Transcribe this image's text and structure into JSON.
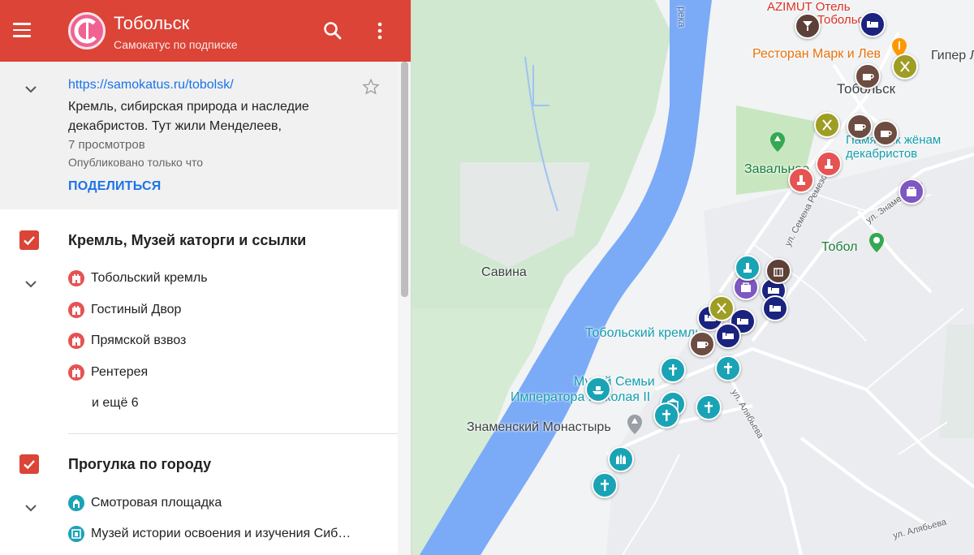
{
  "header": {
    "title": "Тобольск",
    "subtitle": "Самокатус по подписке"
  },
  "info": {
    "url": "https://samokatus.ru/tobolsk/",
    "description": "Кремль, сибирская природа и наследие декабристов. Тут жили Менделеев,",
    "views": "7 просмотров",
    "published": "Опубликовано только что",
    "share_label": "ПОДЕЛИТЬСЯ"
  },
  "layers": [
    {
      "title": "Кремль, Музей каторги и ссылки",
      "checked": true,
      "items": [
        {
          "label": "Тобольский кремль",
          "icon": "fortress-icon",
          "color": "#e55353"
        },
        {
          "label": "Гостиный Двор",
          "icon": "fortress-icon",
          "color": "#e55353"
        },
        {
          "label": "Прямской взвоз",
          "icon": "fortress-icon",
          "color": "#e55353"
        },
        {
          "label": "Рентерея",
          "icon": "fortress-icon",
          "color": "#e55353"
        }
      ],
      "more_label": "и ещё 6"
    },
    {
      "title": "Прогулка по городу",
      "checked": true,
      "items": [
        {
          "label": "Смотровая площадка",
          "icon": "viewpoint-icon",
          "color": "#1aa3b5"
        },
        {
          "label": "Музей истории освоения и изучения Сиб…",
          "icon": "museum-icon",
          "color": "#1aa3b5"
        }
      ]
    }
  ],
  "map": {
    "labels": {
      "river": "река",
      "azimut": "AZIMUT Отель",
      "azimut2": "Тобольск",
      "restaurant": "Ресторан Марк и Лев",
      "giper": "Гипер Л",
      "city": "Тобольск",
      "monument": "Памятник жёнам декабристов",
      "monument1": "Памятник жёнам",
      "monument2": "декабристов",
      "zavalnoe": "Завальное",
      "tobol": "Тобол",
      "savina": "Савина",
      "kremlin": "Тобольский кремль",
      "museum1": "Музей Семьи",
      "museum2": "Императора Николая II",
      "monastery": "Знаменский Монастырь",
      "street_remezova": "ул. Семена Ремезова",
      "street_znamenskogo": "ул. Знаменского",
      "street_alyabyeva": "ул. Алябьева",
      "street_alyabyeva2": "ул. Алябьева"
    }
  },
  "colors": {
    "header": "#db4437",
    "accent": "#1a73e8",
    "water": "#7baaf7",
    "hotel_marker": "#1a237e",
    "cafe_marker": "#795548",
    "church_marker": "#1aa3b5",
    "shop_marker": "#7e57c2",
    "food_marker": "#9e9d24",
    "landmark_marker": "#e55353"
  }
}
